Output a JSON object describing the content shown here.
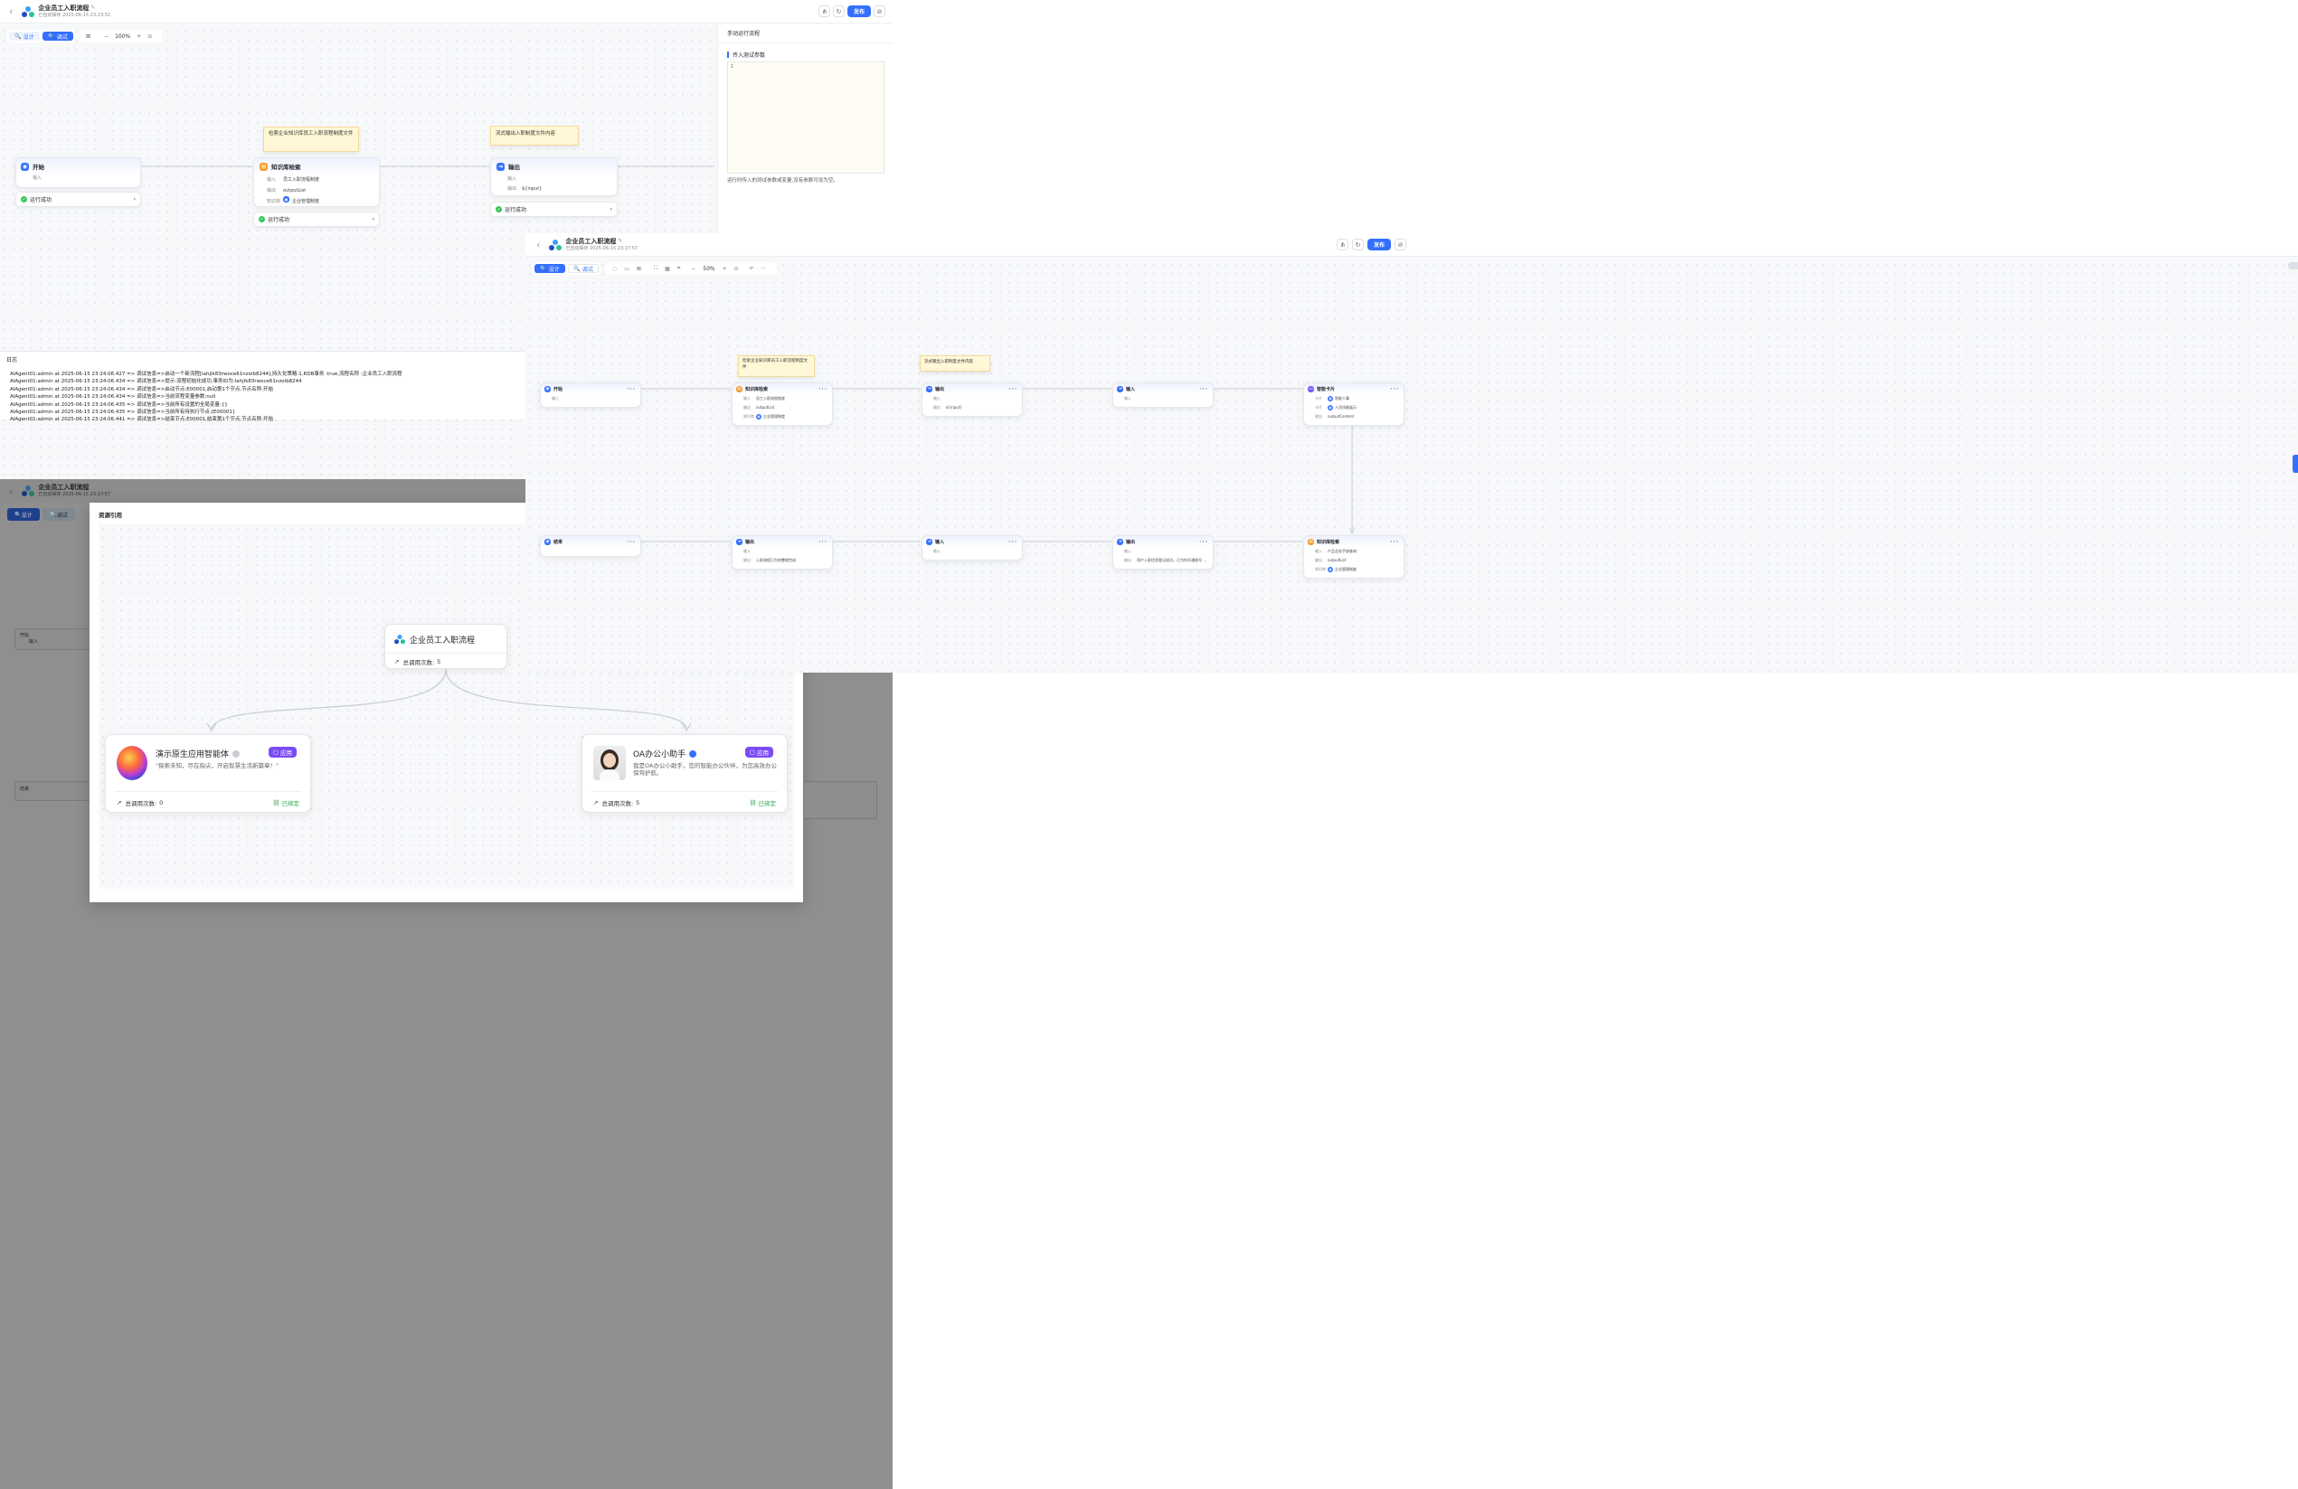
{
  "app": {
    "title": "企业员工入职流程",
    "autosave_a": "已自动保存 2025-06-15 23:23:52",
    "autosave_b": "已自动保存 2025-06-15 23:17:57",
    "publish": "发布"
  },
  "modes": {
    "design": "设计",
    "debug": "调试"
  },
  "zoom": {
    "a": "100%",
    "b": "50%"
  },
  "run_panel": {
    "title": "手动运行流程",
    "section": "传入测试参数",
    "line_no": "1",
    "hint": "运行时传入的测试参数或变量,没有参数可设为空。"
  },
  "flow_a": {
    "start": {
      "title": "开始",
      "input": "输入"
    },
    "kb": {
      "title": "知识库检索",
      "input_k": "输入",
      "input_v": "员工入职流程制度",
      "output_k": "输出",
      "output_v": "outputList",
      "lib_k": "知识库",
      "lib_v": "企业管理制度"
    },
    "out": {
      "title": "输出",
      "input_k": "输入",
      "output_k": "输出",
      "output_v": "${input}"
    },
    "note1": "检索企业知识库员工入职流程制度文件",
    "note2": "流式输出入职制度文件内容",
    "run_ok": "运行成功"
  },
  "log": {
    "title": "日志",
    "lines": [
      "AIAgent01:admin at 2025-06-15 23:24:06.427 => 调试信息=>启动一个新流程[Iahjlk83rwoce61nzoib8244],持久化策略:1,RDB事务 :true,流程名称 :企业员工入职流程",
      "AIAgent01:admin at 2025-06-15 23:24:06.434 => 调试信息=>提示:流程初始化成功,事务ID为:Iahjlk83rwoce61nzoib8244",
      "AIAgent01:admin at 2025-06-15 23:24:06.434 => 调试信息=>启动节点:E00001,启动第1个节点,节点名称:开始",
      "AIAgent01:admin at 2025-06-15 23:24:06.434 => 调试信息=>当前流程变量参数:null",
      "AIAgent01:admin at 2025-06-15 23:24:06.435 => 调试信息=>当前所有设置的全局变量:{}",
      "AIAgent01:admin at 2025-06-15 23:24:06.435 => 调试信息=>当前所有待执行节点:[E00001]",
      "AIAgent01:admin at 2025-06-15 23:24:06.441 => 调试信息=>结束节点:E00001,结束第1个节点,节点名称:开始"
    ]
  },
  "flow_b": {
    "auto_layout": "自动布局",
    "notes": [
      "检索企业知识库员工入职流程制度文件",
      "流式输出入职制度文件内容"
    ],
    "top": [
      {
        "title": "开始",
        "rows": [
          [
            "输入",
            ""
          ]
        ]
      },
      {
        "title": "知识库检索",
        "rows": [
          [
            "输入",
            "员工入职流程制度"
          ],
          [
            "输出",
            "outputList"
          ],
          [
            "知识库",
            "企业管理制度"
          ]
        ]
      },
      {
        "title": "输出",
        "rows": [
          [
            "输入",
            ""
          ],
          [
            "输出",
            "${input}"
          ]
        ]
      },
      {
        "title": "输入",
        "rows": [
          [
            "输入",
            ""
          ]
        ]
      },
      {
        "title": "智能卡片",
        "rows": [
          [
            "卡片",
            "智能人事"
          ],
          [
            "卡片",
            "人员技能展示"
          ],
          [
            "输出",
            "outputContent"
          ]
        ]
      }
    ],
    "bottom": [
      {
        "title": "结束",
        "rows": []
      },
      {
        "title": "输出",
        "rows": [
          [
            "输入",
            ""
          ],
          [
            "输出",
            "入职流程已为你整理完成"
          ]
        ]
      },
      {
        "title": "输入",
        "rows": [
          [
            "输入",
            ""
          ]
        ]
      },
      {
        "title": "输出",
        "rows": [
          [
            "输入",
            ""
          ],
          [
            "输出",
            "用户入职信息登记成功，已为你开通账号 ..."
          ]
        ]
      },
      {
        "title": "知识库检索",
        "rows": [
          [
            "输入",
            "产品业务手册查询"
          ],
          [
            "输出",
            "outputList"
          ],
          [
            "知识库",
            "企业管理制度"
          ]
        ]
      }
    ]
  },
  "resource": {
    "title": "资源引用",
    "center": {
      "title": "企业员工入职流程",
      "calls_label": "总调用次数:",
      "calls": "5"
    },
    "left": {
      "title": "演示原生应用智能体",
      "tag": "应用",
      "desc": "\"探索未知，尽在指尖，开启智慧生活新篇章！\"",
      "calls_label": "总调用次数:",
      "calls": "0",
      "bound": "已绑定"
    },
    "right": {
      "title": "OA办公小助手",
      "tag": "应用",
      "desc": "我是OA办公小助手，您的智能办公伙伴，为您高效办公保驾护航。",
      "calls_label": "总调用次数:",
      "calls": "5",
      "bound": "已绑定"
    },
    "bg_nodes": {
      "start": "开始",
      "start_in": "输入",
      "end": "结束"
    }
  },
  "colors": {
    "primary": "#3370ff",
    "success": "#34c759",
    "note": "#fff7d6",
    "tag": "#7a4cf5"
  }
}
